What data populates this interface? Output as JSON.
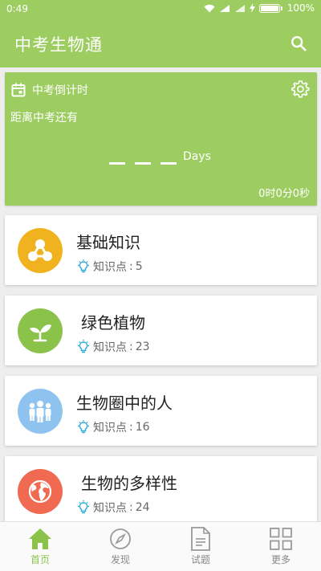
{
  "status_bar": {
    "time": "0:49",
    "battery_percent": "100%",
    "battery_level": 1.0
  },
  "app_bar": {
    "title": "中考生物通",
    "search_icon": "search-icon"
  },
  "countdown": {
    "header": "中考倒计时",
    "subtitle": "距离中考还有",
    "days_unit": "Days",
    "time_remaining": "0时0分0秒"
  },
  "topics": [
    {
      "title": "基础知识",
      "meta_label": "知识点",
      "meta_sep": ":",
      "count": "5",
      "color": "#f0b21e",
      "icon": "network-icon"
    },
    {
      "title": "绿色植物",
      "meta_label": "知识点",
      "meta_sep": ":",
      "count": "23",
      "color": "#8bc34a",
      "icon": "sprout-icon"
    },
    {
      "title": "生物圈中的人",
      "meta_label": "知识点",
      "meta_sep": ":",
      "count": "16",
      "color": "#8ec3f0",
      "icon": "people-icon"
    },
    {
      "title": "生物的多样性",
      "meta_label": "知识点",
      "meta_sep": ":",
      "count": "24",
      "color": "#ef6a50",
      "icon": "globe-icon"
    }
  ],
  "tabs": [
    {
      "label": "首页",
      "icon": "home-icon",
      "active": true
    },
    {
      "label": "发现",
      "icon": "compass-icon",
      "active": false
    },
    {
      "label": "试题",
      "icon": "document-icon",
      "active": false
    },
    {
      "label": "更多",
      "icon": "grid-icon",
      "active": false
    }
  ],
  "colors": {
    "primary": "#9dcd61",
    "tab_active": "#8bc34a",
    "bulb": "#29a8d6"
  }
}
